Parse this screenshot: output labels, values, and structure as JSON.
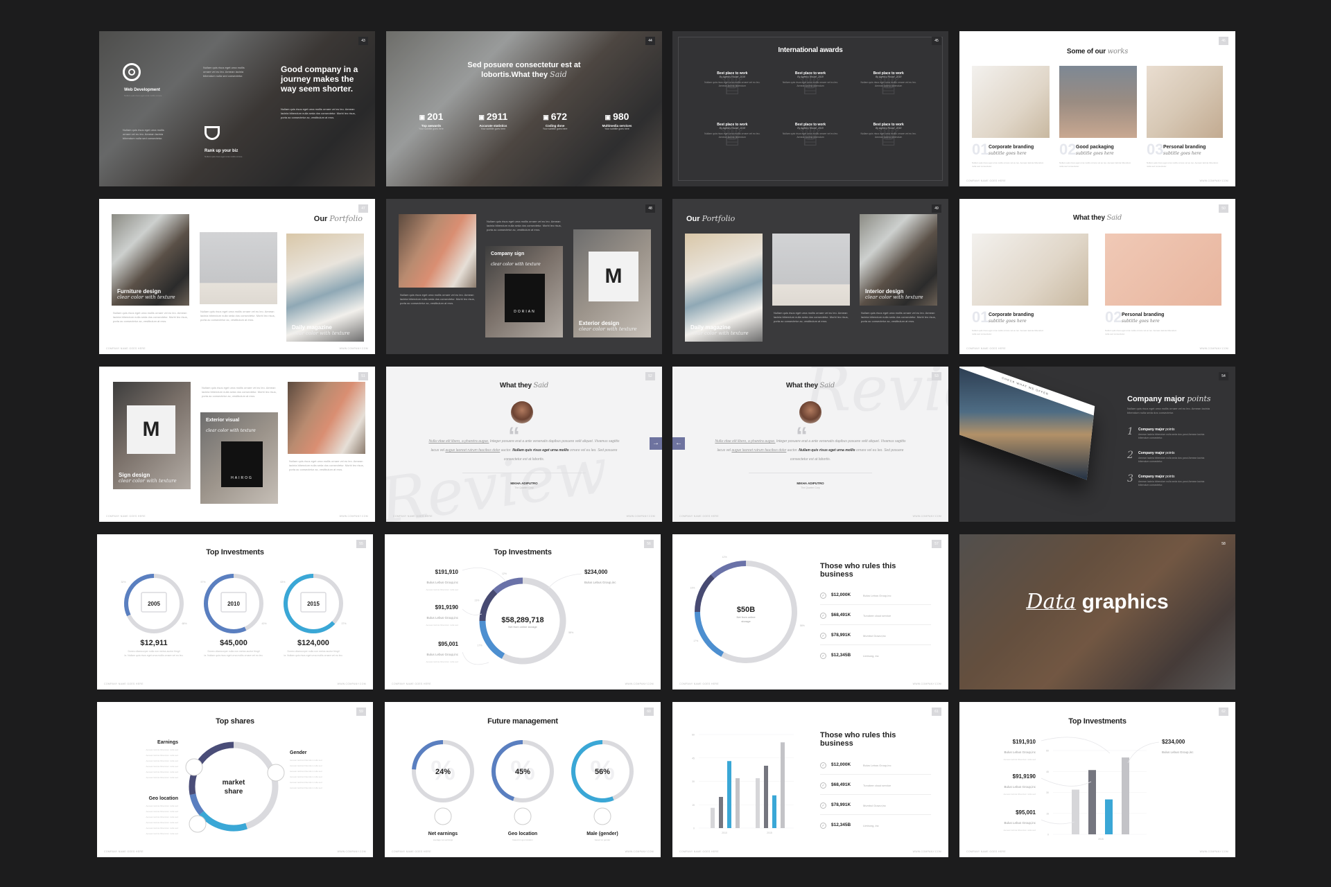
{
  "colors": {
    "background": "#1c1c1d",
    "accent_blue": "#5a7fc0",
    "accent_cyan": "#3aa7d6",
    "accent_navy": "#4a4d78",
    "ring_grey": "#dadade"
  },
  "footer": {
    "left": "COMPANY NAME GOES HERE",
    "right": "WWW.COMPANY.COM"
  },
  "lorem_short": "Nullam quis risus eget urna mollis ornare vel eu leo. Aenean lacinia bibendum nulla sed consectetur.",
  "lorem_long": "Nullam quis risus eget urna mollis ornare vel eu leo. Aenean lacinia bibendum nulla seda dos consectetur. Morbi leo risus, porta ac consectetur ac, vestibulum at eros.",
  "slides": {
    "s1": {
      "page": "43",
      "services": [
        {
          "icon": "lifebuoy-icon",
          "title": "Web Development",
          "sub": "Nullam quis risus eget urna mollis ornare"
        },
        {
          "icon": "trophy-icon",
          "title": "Rank up your biz",
          "sub": "Nullam quis risus eget urna mollis ornare"
        }
      ],
      "headline": "Good company in a journey makes the way seem shorter."
    },
    "s2": {
      "page": "44",
      "headline": "Sed posuere consectetur est at lobortis.What they",
      "headline_it": "Said",
      "stats": [
        {
          "icon": "award-icon",
          "value": "201",
          "label": "Top awwards",
          "sub": "Your subtitle goes here"
        },
        {
          "icon": "bar-chart-icon",
          "value": "2911",
          "label": "Accurate statistics",
          "sub": "Your subtitle goes here"
        },
        {
          "icon": "code-window-icon",
          "value": "672",
          "label": "Coding done",
          "sub": "Your subtitle goes here"
        },
        {
          "icon": "presentation-icon",
          "value": "980",
          "label": "Multimedia services",
          "sub": "Your subtitle goes here"
        }
      ]
    },
    "s3": {
      "page": "45",
      "title": "International awards",
      "awards": [
        {
          "title": "Best place to work",
          "by": "By Agency House_2018"
        },
        {
          "title": "Best place to work",
          "by": "By Agency House_2018"
        },
        {
          "title": "Best place to work",
          "by": "By Agency House_2018"
        },
        {
          "title": "Best place to work",
          "by": "By Agency House_2018"
        },
        {
          "title": "Best place to work",
          "by": "By Agency House_2018"
        },
        {
          "title": "Best place to work",
          "by": "By Agency House_2018"
        }
      ],
      "award_text": "Nullam quis risus eget urna mollis ornare vel eu leo. Aenean lacinia bibendum"
    },
    "s4": {
      "page": "46",
      "title": "Some of our",
      "title_it": "works",
      "items": [
        {
          "num": "01",
          "title": "Corporate branding",
          "sub": "subtitle goes here"
        },
        {
          "num": "02",
          "title": "Good packaging",
          "sub": "subtitle goes here"
        },
        {
          "num": "03",
          "title": "Personal branding",
          "sub": "subtitle goes here"
        }
      ]
    },
    "s5": {
      "page": "47",
      "title": "Our",
      "title_it": "Portfolio",
      "caps": [
        {
          "title": "Furniture design",
          "sub": "clear color with texture"
        },
        {
          "title": "Daily magazine",
          "sub": "clear color with texture"
        }
      ]
    },
    "s6": {
      "page": "48",
      "caps": [
        {
          "title": "Company sign",
          "sub": "clear color with texture"
        },
        {
          "title": "Exterior design",
          "sub": "clear color with texture"
        }
      ],
      "sign_text": "DORIAN"
    },
    "s7": {
      "page": "49",
      "title": "Our",
      "title_it": "Portfolio",
      "caps": [
        {
          "title": "Daily magazine",
          "sub": "clear color with texture"
        },
        {
          "title": "Interior design",
          "sub": "clear color with texture"
        }
      ]
    },
    "s8": {
      "page": "50",
      "title": "What they",
      "title_it": "Said",
      "items": [
        {
          "num": "01",
          "title": "Corporate branding",
          "sub": "subtitle goes here"
        },
        {
          "num": "02",
          "title": "Personal branding",
          "sub": "subtitle goes here"
        }
      ]
    },
    "s9": {
      "page": "51",
      "caps": [
        {
          "title": "Sign design",
          "sub": "clear color with texture"
        },
        {
          "title": "Exterior visual",
          "sub": "clear color with texture"
        }
      ],
      "sign_text": "HAIROG"
    },
    "s10": {
      "page": "52",
      "title": "What they",
      "title_it": "Said",
      "quote_u": "Nulla vitae elit libero, a pharetra augue.",
      "quote_1": " Integer posuere erat a ante venenatis dapibus posuere velit aliquet. Vivamus sagittis lacus vel ",
      "quote_u2": "augue laoreet rutrum faucibus dolor",
      "quote_2": " auctor. ",
      "quote_b": "Nullam quis risus eget urna mollis",
      "quote_3": " ornare vel eu leo. Sed posuere consectetur est at lobortis.",
      "name": "MIKHA ADIPUTRO",
      "role": "The Quarter Corp",
      "watermark": "Review"
    },
    "s11": {
      "page": "53",
      "title": "What they",
      "title_it": "Said",
      "name": "MIKHA ADIPUTRO",
      "role": "The Quarter Corp",
      "watermark": "Review"
    },
    "s12": {
      "page": "54",
      "title": "Company major",
      "title_it": "points",
      "intro": "Nullam quis risus eget urna mollis ornare vel eu leo. Aenean lacinia bibendum nulla seda dos consectetur.",
      "points": [
        {
          "n": "1",
          "bold": "Company major",
          "rest": "points",
          "text": "Aenean lacinia bibendum nulla seda dos parui Aenean lacinia bibendum consectetur."
        },
        {
          "n": "2",
          "bold": "Company major",
          "rest": "points",
          "text": "Aenean lacinia bibendum nulla seda dos parui Aenean lacinia bibendum consectetur."
        },
        {
          "n": "3",
          "bold": "Company major",
          "rest": "points",
          "text": "Aenean lacinia bibendum nulla seda dos parui Aenean lacinia bibendum consectetur."
        }
      ],
      "mock_text": "CHECK WHAT WE OFFER"
    },
    "s13": {
      "page": "55",
      "title": "Top Investments"
    },
    "s14": {
      "page": "56",
      "title": "Top Investments"
    },
    "s15": {
      "page": "57",
      "title": "Those who rules this business"
    },
    "s16": {
      "page": "58",
      "title_it": "Data",
      "title": "graphics"
    },
    "s17": {
      "page": "59",
      "title": "Top shares"
    },
    "s18": {
      "page": "60",
      "title": "Future management"
    },
    "s19": {
      "page": "61",
      "title": "Those who rules this business"
    },
    "s20": {
      "page": "62",
      "title": "Top Investments"
    }
  },
  "chart_data": [
    {
      "type": "pie",
      "id": "top-investments-rings",
      "title": "Top Investments",
      "rings": [
        {
          "label": "2005",
          "fill": 0.32,
          "pct_a": "32%",
          "pct_b": "68%",
          "value": "$12,911"
        },
        {
          "label": "2010",
          "fill": 0.57,
          "pct_a": "57%",
          "pct_b": "43%",
          "value": "$45,000"
        },
        {
          "label": "2015",
          "fill": 0.63,
          "pct_a": "63%",
          "pct_b": "37%",
          "value": "$124,000"
        }
      ],
      "caption": "Donec ullamcorper nulla non metus auctor fringilla. Nullam quis risus eget urna mollis ornare vel eu leo."
    },
    {
      "type": "pie",
      "id": "top-investments-donut",
      "title": "Top Investments",
      "center_value": "$58,289,718",
      "center_label": "Net from online storage",
      "slices": [
        {
          "label": "12%",
          "value": 12,
          "color": "#6a72a8"
        },
        {
          "label": "13%",
          "value": 13,
          "color": "#474a72"
        },
        {
          "label": "17%",
          "value": 17,
          "color": "#4d8fd0"
        },
        {
          "label": "58%",
          "value": 58,
          "color": "#dadade"
        }
      ],
      "callouts": [
        {
          "value": "$191,910",
          "company": "Bulus Lebus Group,inc"
        },
        {
          "value": "$91,9190",
          "company": "Bulus Lebus Group,inc"
        },
        {
          "value": "$95,001",
          "company": "Bulus Lebus Group,inc"
        },
        {
          "value": "$234,000",
          "company": "Bulus Lebus Group,inc"
        }
      ]
    },
    {
      "type": "pie",
      "id": "rulers-donut",
      "title": "Those who rules this business",
      "center_value": "$50B",
      "center_label": "Net from online storage",
      "slices": [
        {
          "label": "12%",
          "value": 12,
          "color": "#6a72a8"
        },
        {
          "label": "13%",
          "value": 13,
          "color": "#474a72"
        },
        {
          "label": "17%",
          "value": 17,
          "color": "#4d8fd0"
        },
        {
          "label": "58%",
          "value": 58,
          "color": "#dadade"
        }
      ],
      "list": [
        {
          "value": "$12,000K",
          "name": "Bulus Lebus Group,inc"
        },
        {
          "value": "$68,491K",
          "name": "Tunobee cloud service"
        },
        {
          "value": "$78,991K",
          "name": "Mumbul Duwur,inc"
        },
        {
          "value": "$12,345B",
          "name": "Limbung, inc"
        }
      ]
    },
    {
      "type": "pie",
      "id": "top-shares",
      "title": "Top shares",
      "center_label": "market share",
      "slices": [
        {
          "label": "Earnings",
          "value": 28,
          "color": "#4a4d78"
        },
        {
          "label": "Geo location",
          "value": 27,
          "color": "#3aa7d6"
        },
        {
          "label": "Gender",
          "value": 45,
          "color": "#dadade"
        }
      ]
    },
    {
      "type": "pie",
      "id": "future-management",
      "title": "Future management",
      "rings": [
        {
          "value": "24%",
          "fill": 0.24,
          "label": "Net earnings",
          "sub": "average net earnings",
          "icon": "mail-icon"
        },
        {
          "value": "45%",
          "fill": 0.45,
          "label": "Geo location",
          "sub": "based on geo location",
          "icon": "share-icon"
        },
        {
          "value": "56%",
          "fill": 0.56,
          "label": "Male (gender)",
          "sub": "based on gender",
          "icon": "chat-icon"
        }
      ]
    },
    {
      "type": "bar",
      "id": "rulers-bars",
      "categories": [
        "2010",
        "2015"
      ],
      "series": [
        {
          "name": "s1",
          "values": [
            13,
            32
          ],
          "color": "#d6d6d9"
        },
        {
          "name": "s2",
          "values": [
            20,
            40
          ],
          "color": "#75767f"
        },
        {
          "name": "s3",
          "values": [
            43,
            21
          ],
          "color": "#3aa7d6"
        },
        {
          "name": "s4",
          "values": [
            32,
            55
          ],
          "color": "#c3c3c7"
        }
      ],
      "yticks": [
        "0",
        "15",
        "30",
        "45",
        "60"
      ],
      "ylim": [
        0,
        60
      ],
      "list": [
        {
          "value": "$12,000K",
          "name": "Bulus Lebus Group,inc"
        },
        {
          "value": "$68,491K",
          "name": "Tunobee cloud service"
        },
        {
          "value": "$78,991K",
          "name": "Mumbul Duwur,inc"
        },
        {
          "value": "$12,345B",
          "name": "Limbung, inc"
        }
      ]
    },
    {
      "type": "bar",
      "id": "top-investments-bars",
      "title": "Top Investments",
      "categories": [
        "2015"
      ],
      "values": [
        32,
        46,
        25,
        55
      ],
      "colors": [
        "#d6d6d9",
        "#75767f",
        "#3aa7d6",
        "#c3c3c7"
      ],
      "yticks": [
        "0",
        "15",
        "30",
        "45",
        "60"
      ],
      "ylim": [
        0,
        60
      ],
      "callouts": [
        {
          "value": "$191,910",
          "company": "Bulus Lebus Group,inc"
        },
        {
          "value": "$91,9190",
          "company": "Bulus Lebus Group,inc"
        },
        {
          "value": "$95,001",
          "company": "Bulus Lebus Group,inc"
        },
        {
          "value": "$234,000",
          "company": "Bulus Lebus Group,inc"
        }
      ]
    }
  ],
  "nav": {
    "prev": "previous-arrow",
    "next": "next-arrow"
  }
}
